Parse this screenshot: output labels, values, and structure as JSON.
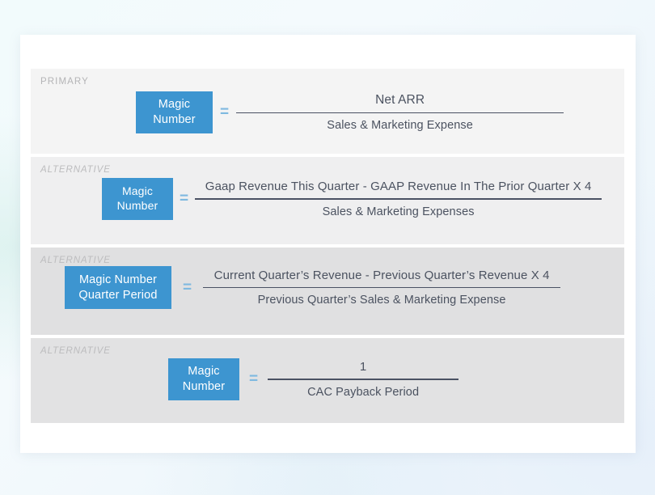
{
  "page": {
    "background_accent": "#f0f8fb",
    "card_background": "#ffffff"
  },
  "theme": {
    "brand_blue": "#3d95d0",
    "equals_blue": "#7fb9e0",
    "rule_color": "#4a5163",
    "text_color": "#4b5260",
    "kicker_color": "#b9b9bb",
    "row_bg_1": "#f4f4f4",
    "row_bg_2": "#efeff0",
    "row_bg_3": "#e0e0e1",
    "row_bg_4": "#e2e2e3"
  },
  "rows": [
    {
      "kicker": "PRIMARY",
      "box_line_1": "Magic",
      "box_line_2": "Number",
      "equals": "=",
      "numerator": "Net ARR",
      "denominator": "Sales & Marketing Expense",
      "multiplier": ""
    },
    {
      "kicker": "ALTERNATIVE",
      "box_line_1": "Magic",
      "box_line_2": "Number",
      "equals": "=",
      "numerator": "Gaap Revenue This Quarter - GAAP Revenue In The Prior Quarter",
      "denominator": "Sales & Marketing Expenses",
      "multiplier": "X  4"
    },
    {
      "kicker": "ALTERNATIVE",
      "box_line_1": "Magic Number",
      "box_line_2": "Quarter Period",
      "equals": "=",
      "numerator": "Current Quarter’s Revenue - Previous Quarter’s Revenue",
      "denominator": "Previous Quarter’s Sales & Marketing Expense",
      "multiplier": "X  4"
    },
    {
      "kicker": "ALTERNATIVE",
      "box_line_1": "Magic",
      "box_line_2": "Number",
      "equals": "=",
      "numerator": "1",
      "denominator": "CAC Payback Period",
      "multiplier": ""
    }
  ]
}
